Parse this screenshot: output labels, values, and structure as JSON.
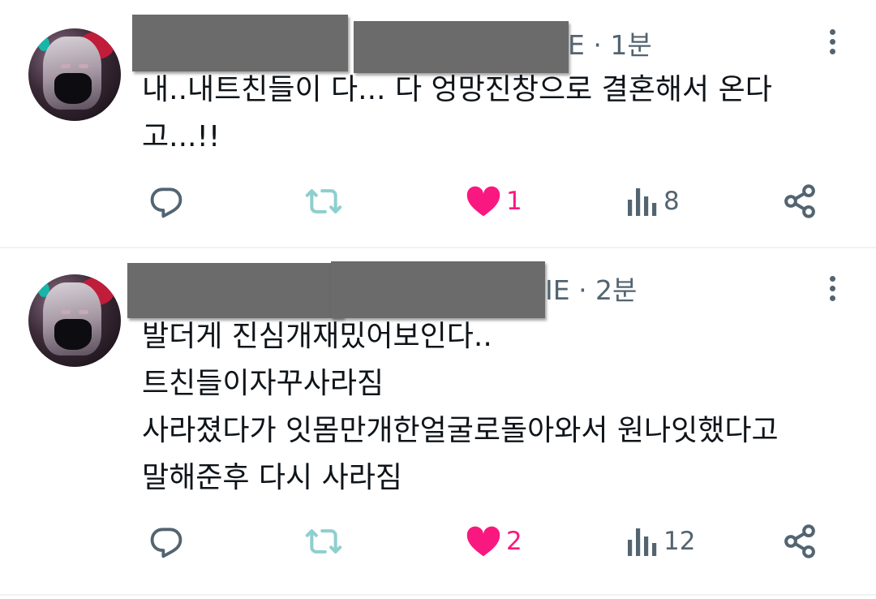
{
  "tweets": [
    {
      "handle_tail": "E · 1분",
      "lines": [
        "내..내트친들이 다... 다 엉망진창으로 결혼해서 온다",
        "고...!!"
      ],
      "likes": "1",
      "views": "8"
    },
    {
      "handle_tail": "IE · 2분",
      "lines": [
        "발더게 진심개재밌어보인다..",
        "트친들이자꾸사라짐",
        "사라졌다가 잇몸만개한얼굴로돌아와서 원나잇했다고",
        "말해준후 다시 사라짐"
      ],
      "likes": "2",
      "views": "12"
    }
  ],
  "icons": {
    "reply": "reply-icon",
    "retweet": "retweet-icon",
    "like": "heart-icon",
    "views": "analytics-icon",
    "share": "share-icon",
    "more": "more-icon"
  },
  "colors": {
    "like": "#f91880",
    "icon": "#536471",
    "retweet_faded": "#8ecfce",
    "redaction": "#6b6b6b"
  }
}
